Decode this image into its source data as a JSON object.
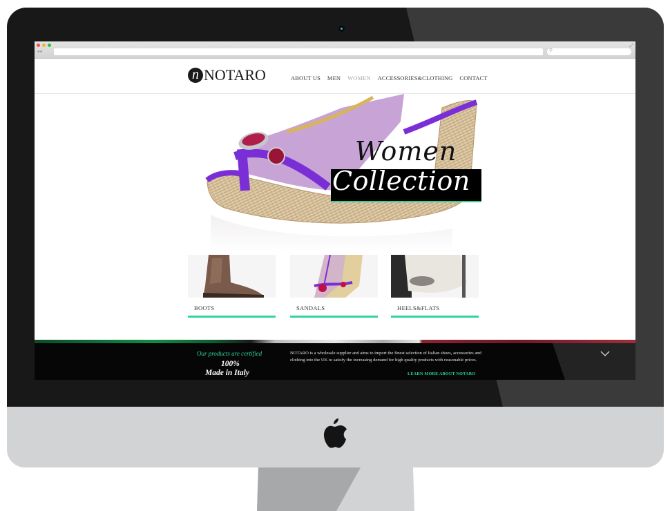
{
  "device": {
    "camera_icon": "webcam-dot",
    "logo_icon": "apple-logo"
  },
  "browser": {
    "window_controls": [
      "close",
      "minimize",
      "maximize"
    ],
    "back_forward_icons": "◂ ▸",
    "url": "",
    "search_placeholder": "",
    "search_icon": "⚲",
    "resize_icon": "⤢"
  },
  "site": {
    "logo": {
      "mark": "n",
      "text": "NOTARO"
    },
    "nav": [
      {
        "label": "ABOUT US",
        "active": false
      },
      {
        "label": "MEN",
        "active": false
      },
      {
        "label": "WOMEN",
        "active": true
      },
      {
        "label": "ACCESSORIES&CLOTHING",
        "active": false
      },
      {
        "label": "CONTACT",
        "active": false
      }
    ],
    "hero": {
      "title_line1": "Women",
      "title_line2": "Collection",
      "image": "purple-wedge-sandal"
    },
    "categories": [
      {
        "label": "BOOTS",
        "image": "brown-boot"
      },
      {
        "label": "SANDALS",
        "image": "purple-jeweled-sandal"
      },
      {
        "label": "HEELS&FLATS",
        "image": "white-peep-toe-heel"
      }
    ],
    "accent_color": "#2ed3a0",
    "footer": {
      "certified_label": "Our products are certified",
      "percent": "100%",
      "made_in": "Made in Italy",
      "about_text": "NOTARO is a wholesale supplier and aims to import the finest selection of Italian shoes, accessories and clothing into the UK to satisfy the increasing demand for high quality products with reasonable prices.",
      "learn_more": "LEARN MORE ABOUT NOTARO",
      "scroll_icon": "chevron-down"
    }
  }
}
